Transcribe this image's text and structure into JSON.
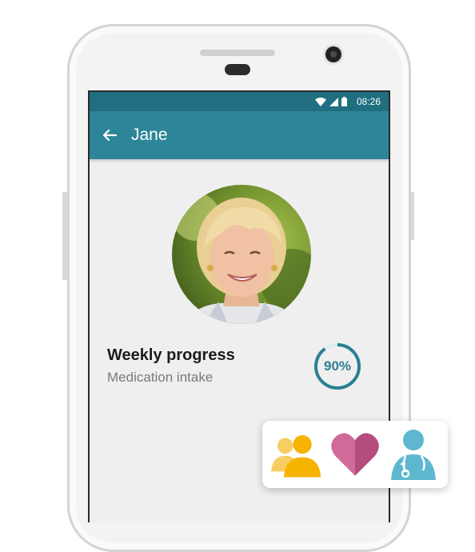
{
  "status_bar": {
    "time": "08:26",
    "icons": [
      "wifi-icon",
      "cell-signal-icon",
      "battery-icon"
    ]
  },
  "app_bar": {
    "back_icon": "arrow-back-icon",
    "title": "Jane"
  },
  "profile": {
    "avatar": "profile-photo"
  },
  "progress": {
    "title": "Weekly progress",
    "subtitle": "Medication intake",
    "percent_label": "90%",
    "value": 0.9
  },
  "feature_icons": [
    "group-icon",
    "heart-icon",
    "doctor-icon"
  ],
  "colors": {
    "status_bar": "#1f6f80",
    "app_bar": "#2d8599",
    "ring": "#2a7f93",
    "group": "#f6b400",
    "heart": "#c4568a",
    "doctor": "#5db8cf"
  }
}
